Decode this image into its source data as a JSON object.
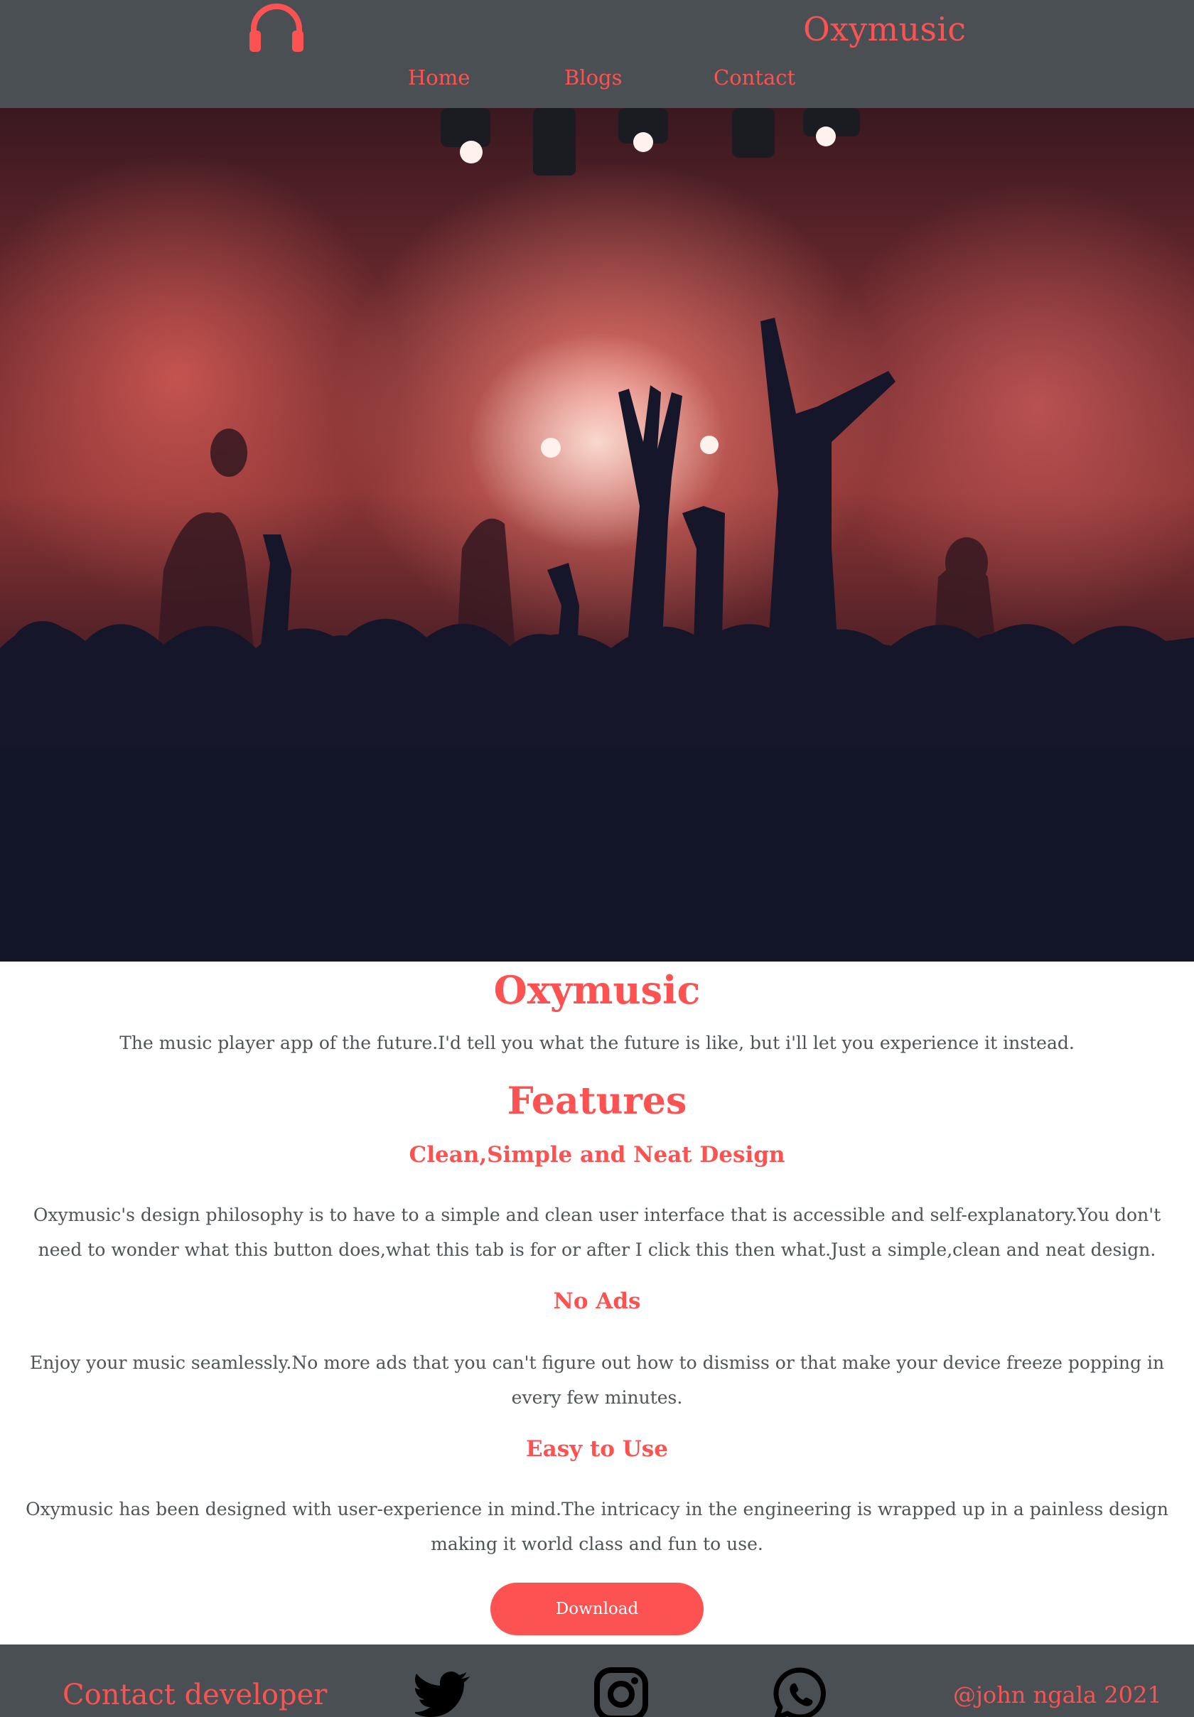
{
  "header": {
    "brand": "Oxymusic",
    "logo_icon": "headphones-icon",
    "nav": [
      {
        "label": "Home"
      },
      {
        "label": "Blogs"
      },
      {
        "label": "Contact"
      }
    ]
  },
  "hero": {
    "image": "concert-crowd-photo"
  },
  "main": {
    "title": "Oxymusic",
    "tagline": "The music player app of the future.I'd tell you what the future is like, but i'll let you experience it instead.",
    "features_heading": "Features",
    "features": [
      {
        "heading": "Clean,Simple and Neat Design",
        "text": "Oxymusic's design philosophy is to have to a simple and clean user interface that is accessible and self-explanatory.You don't need to wonder what this button does,what this tab is for or after I click this then what.Just a simple,clean and neat design."
      },
      {
        "heading": "No Ads",
        "text": "Enjoy your music seamlessly.No more ads that you can't figure out how to dismiss or that make your device freeze popping in every few minutes."
      },
      {
        "heading": "Easy to Use",
        "text": "Oxymusic has been designed with user-experience in mind.The intricacy in the engineering is wrapped up in a painless design making it world class and fun to use."
      }
    ],
    "download_label": "Download"
  },
  "footer": {
    "contact_label": "Contact developer",
    "social": [
      "twitter-icon",
      "instagram-icon",
      "whatsapp-icon"
    ],
    "credit": "@john ngala 2021"
  },
  "colors": {
    "accent": "#fc5352",
    "header_bg": "#4a4f54",
    "body_text": "#4f5457"
  }
}
